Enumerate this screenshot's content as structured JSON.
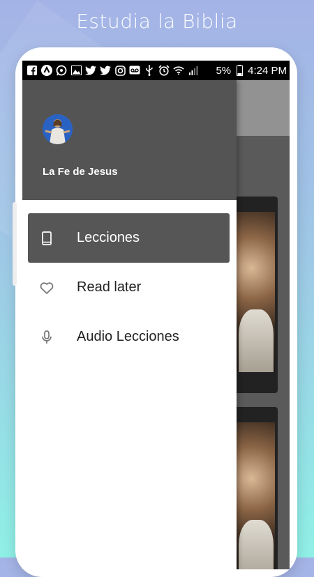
{
  "promo": {
    "title": "Estudia la Biblia"
  },
  "status_bar": {
    "battery": "5%",
    "time": "4:24 PM",
    "icons": [
      "facebook-icon",
      "arrow-up-icon",
      "whatsapp-icon",
      "image-icon",
      "twitter-icon",
      "twitter-icon",
      "instagram-icon",
      "voicemail-icon",
      "usb-icon",
      "alarm-icon",
      "wifi-icon",
      "signal-icon",
      "battery-icon"
    ]
  },
  "drawer": {
    "app_name": "La Fe de Jesus",
    "items": [
      {
        "label": "Lecciones",
        "icon": "book-icon",
        "active": true
      },
      {
        "label": "Read later",
        "icon": "heart-icon",
        "active": false
      },
      {
        "label": "Audio Lecciones",
        "icon": "microphone-icon",
        "active": false
      }
    ]
  },
  "colors": {
    "drawer_header": "#545454",
    "active_item": "#565656",
    "status_bar": "#000000"
  }
}
